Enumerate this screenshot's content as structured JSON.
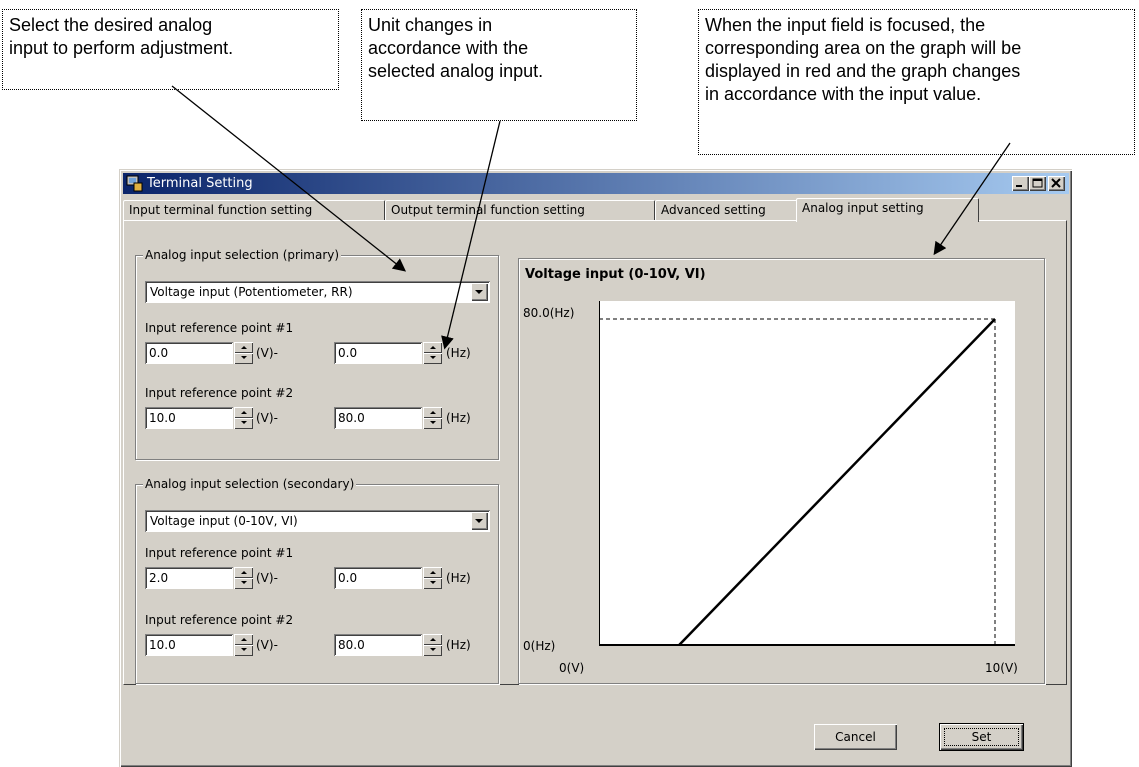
{
  "callouts": {
    "analog_select": "Select the desired analog\ninput to perform adjustment.",
    "unit_change": "Unit changes in\naccordance with the\nselected analog input.",
    "graph_focus": "When the input field is focused, the\ncorresponding area on the graph will be\ndisplayed in red and the graph changes\nin accordance with the input value."
  },
  "window": {
    "title": "Terminal Setting",
    "tabs": [
      {
        "label": "Input terminal function setting"
      },
      {
        "label": "Output terminal function setting"
      },
      {
        "label": "Advanced setting"
      },
      {
        "label": "Analog input setting",
        "active": true
      }
    ]
  },
  "primary": {
    "legend": "Analog input selection (primary)",
    "selection": "Voltage input (Potentiometer, RR)",
    "point1": {
      "label": "Input reference point #1",
      "value_a": "0.0",
      "unit_a": "(V)-",
      "value_b": "0.0",
      "unit_b": "(Hz)"
    },
    "point2": {
      "label": "Input reference point #2",
      "value_a": "10.0",
      "unit_a": "(V)-",
      "value_b": "80.0",
      "unit_b": "(Hz)"
    }
  },
  "secondary": {
    "legend": "Analog input selection (secondary)",
    "selection": "Voltage input (0-10V, VI)",
    "point1": {
      "label": "Input reference point #1",
      "value_a": "2.0",
      "unit_a": "(V)-",
      "value_b": "0.0",
      "unit_b": "(Hz)"
    },
    "point2": {
      "label": "Input reference point #2",
      "value_a": "10.0",
      "unit_a": "(V)-",
      "value_b": "80.0",
      "unit_b": "(Hz)"
    }
  },
  "graph": {
    "title": "Voltage input (0-10V, VI)",
    "y_top_label": "80.0(Hz)",
    "y_bottom_label": "0(Hz)",
    "x_left_label": "0(V)",
    "x_right_label": "10(V)"
  },
  "chart_data": {
    "type": "line",
    "title": "Voltage input (0-10V, VI)",
    "xlim": [
      0,
      10
    ],
    "ylim": [
      0,
      80
    ],
    "series": [
      {
        "x": [
          2,
          10
        ],
        "y": [
          0,
          80
        ]
      }
    ]
  },
  "buttons": {
    "cancel": "Cancel",
    "set": "Set"
  }
}
